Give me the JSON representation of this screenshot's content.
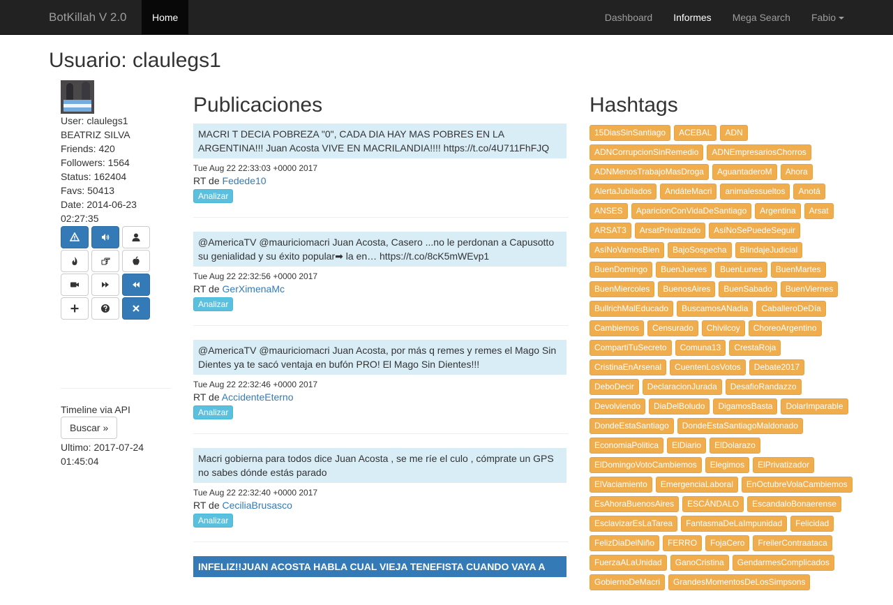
{
  "navbar": {
    "brand": "BotKillah V 2.0",
    "home": "Home",
    "right": [
      {
        "label": "Dashboard"
      },
      {
        "label": "Informes"
      },
      {
        "label": "Mega Search"
      }
    ],
    "user": "Fabio"
  },
  "page": {
    "title": "Usuario: claulegs1"
  },
  "profile": {
    "lines": [
      "User: claulegs1",
      "BEATRIZ SILVA",
      "Friends: 420",
      "Followers: 1564",
      "Status: 162404",
      "Favs: 50413",
      "Date: 2014-06-23",
      "02:27:35"
    ]
  },
  "actions": {
    "icons": [
      "warning-icon",
      "volume-icon",
      "user-icon",
      "fire-icon",
      "hand-point-icon",
      "apple-icon",
      "video-icon",
      "fast-forward-icon",
      "fast-backward-icon",
      "plus-icon",
      "question-icon",
      "close-icon"
    ]
  },
  "timeline": {
    "label": "Timeline via API",
    "button": "Buscar »",
    "ultimo": "Ultimo: 2017-07-24",
    "ultimo_time": "01:45:04"
  },
  "publicaciones": {
    "title": "Publicaciones",
    "rt_prefix": "RT de ",
    "analyze_label": "Analizar",
    "posts": [
      {
        "text": "MACRI T DECIA POBREZA \"0\", CADA DIA HAY MAS POBRES EN LA ARGENTINA!!! Juan Acosta VIVE EN MACRILANDIA!!!! https://t.co/4U711FhFJQ",
        "date": "Tue Aug 22 22:33:03 +0000 2017",
        "author": "Fedede10"
      },
      {
        "text": "@AmericaTV @mauriciomacri Juan Acosta, Casero ...no le perdonan a Capusotto su genialidad y su éxito popular➡ la en… https://t.co/8cK5mWEvp1",
        "date": "Tue Aug 22 22:32:56 +0000 2017",
        "author": "GerXimenaMc"
      },
      {
        "text": "@AmericaTV @mauriciomacri Juan Acosta, por más q remes y remes el Mago Sin Dientes ya te sacó ventaja en bufón PRO! El Mago Sin Dientes!!!",
        "date": "Tue Aug 22 22:32:46 +0000 2017",
        "author": "AccidenteEterno"
      },
      {
        "text": "Macri gobierna para todos dice Juan Acosta , se me ríe el culo , cómprate un GPS no sabes dónde estás parado",
        "date": "Tue Aug 22 22:32:40 +0000 2017",
        "author": "CeciliaBrusasco"
      },
      {
        "text": "INFELIZ!!JUAN ACOSTA HABLA CUAL VIEJA TENEFISTA CUANDO VAYA A",
        "date": "",
        "author": ""
      }
    ]
  },
  "hashtags": {
    "title": "Hashtags",
    "tags": [
      "15DiasSinSantiago",
      "ACEBAL",
      "ADN",
      "ADNCorrupcionSinRemedio",
      "ADNEmpresariosChorros",
      "ADNMenosTrabajoMasDroga",
      "AguantaderoM",
      "Ahora",
      "AlertaJubilados",
      "AndáteMacri",
      "animalessueltos",
      "Anotá",
      "ANSES",
      "AparicionConVidaDeSantiago",
      "Argentina",
      "Arsat",
      "ARSAT3",
      "ArsatPrivatizado",
      "AsíNoSePuedeSeguir",
      "AsíNoVamosBien",
      "BajoSospecha",
      "BlindajeJudicial",
      "BuenDomingo",
      "BuenJueves",
      "BuenLunes",
      "BuenMartes",
      "BuenMiercoles",
      "BuenosAires",
      "BuenSabado",
      "BuenViernes",
      "BullrichMalEducado",
      "BuscamosANadia",
      "CaballeroDeDía",
      "Cambiemos",
      "Censurado",
      "Chivilcoy",
      "ChoreoArgentino",
      "CompartiTuSecreto",
      "Comuna13",
      "CrestaRoja",
      "CristinaEnArsenal",
      "CuentenLosVotos",
      "Debate2017",
      "DeboDecir",
      "DeclaracionJurada",
      "DesafioRandazzo",
      "Devolviendo",
      "DiaDelBoludo",
      "DigamosBasta",
      "DolarImparable",
      "DondeEstaSantiago",
      "DondeEstaSantiagoMaldonado",
      "EconomiaPolitica",
      "ElDiario",
      "ElDolarazo",
      "ElDomingoVotoCambiemos",
      "Elegimos",
      "ElPrivatizador",
      "ElVaciamiento",
      "EmergenciaLaboral",
      "EnOctubreVolaCambiemos",
      "EsAhoraBuenosAires",
      "ESCÁNDALO",
      "EscandaloBonaerense",
      "EsclavizarEsLaTarea",
      "FantasmaDeLaImpunidad",
      "Felicidad",
      "FelizDiaDelNiño",
      "FERRO",
      "FojaCero",
      "FreilerContraataca",
      "FuerzaALaUnidad",
      "GanoCristina",
      "GendarmesComplicados",
      "GobiernoDeMacri",
      "GrandesMomentosDeLosSimpsons"
    ]
  }
}
